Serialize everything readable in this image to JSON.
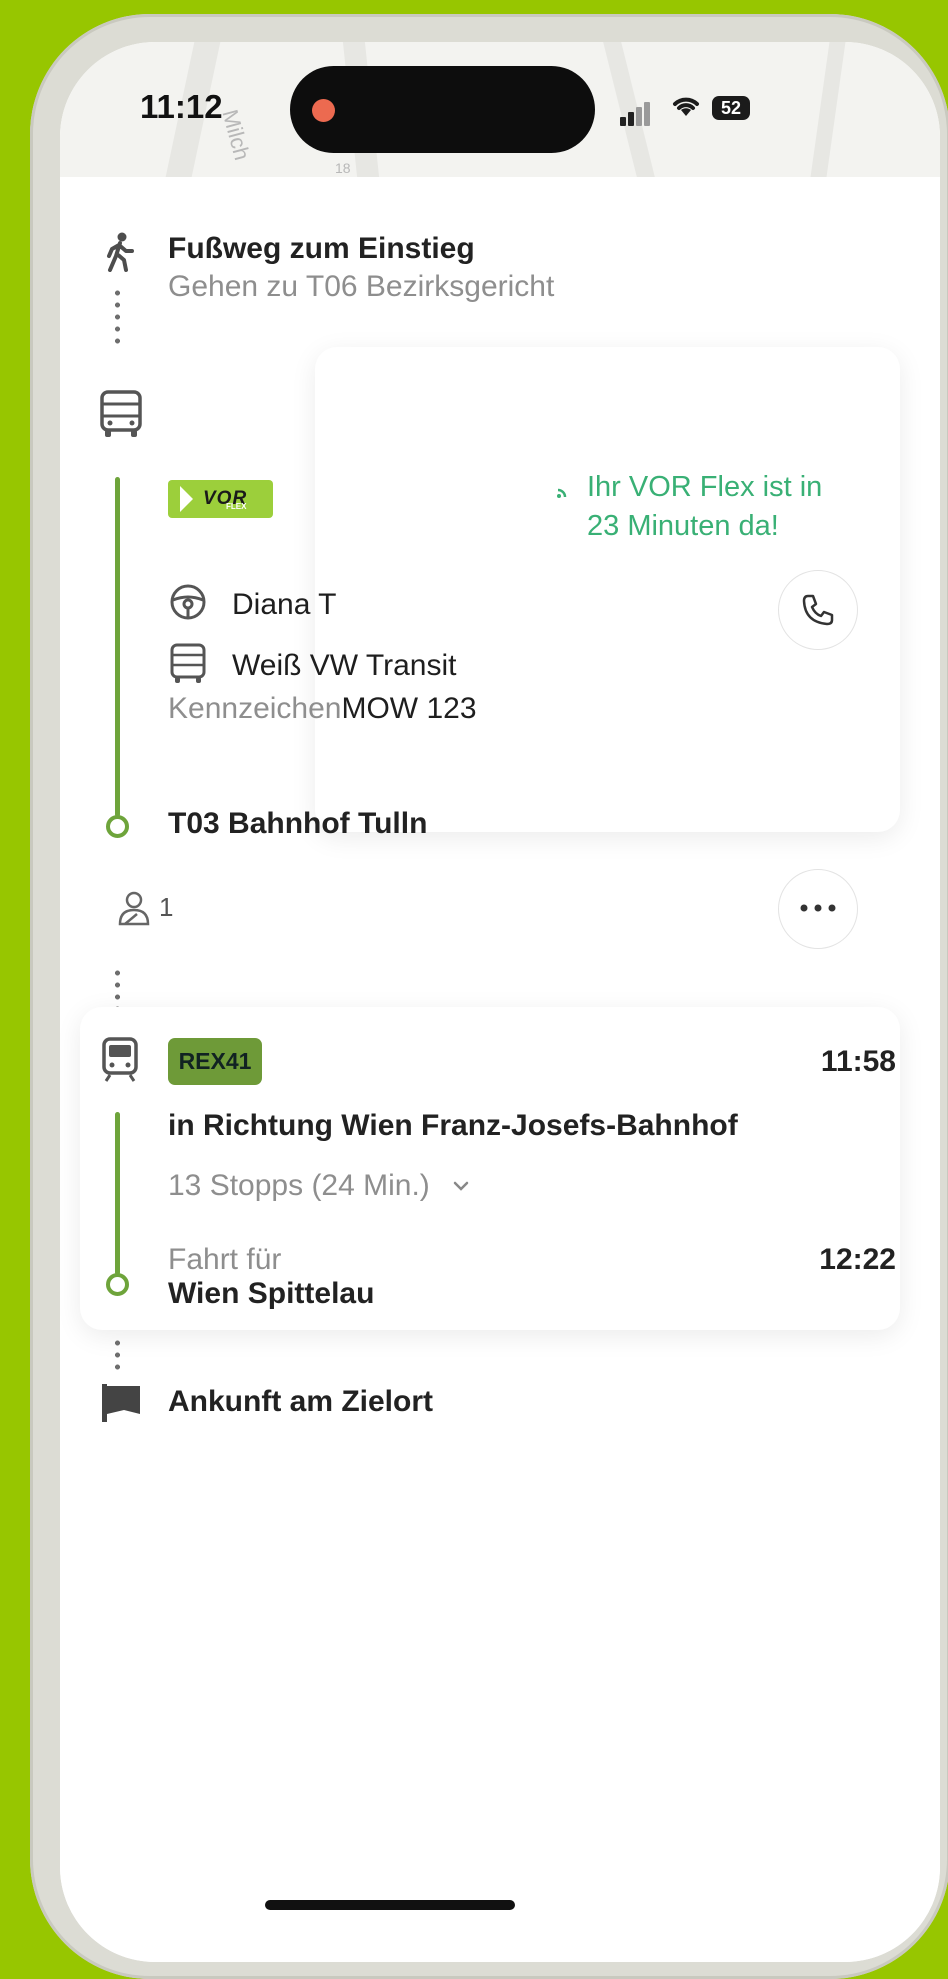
{
  "status_bar": {
    "time": "11:12",
    "battery": "52"
  },
  "map": {
    "street_label": "Milch",
    "number_label": "18"
  },
  "walk_step": {
    "title": "Fußweg zum Einstieg",
    "subtitle": "Gehen zu T06 Bezirksgericht"
  },
  "flex_leg": {
    "brand": "VOR",
    "brand_sub": "FLEX",
    "eta_message": "Ihr VOR Flex ist in 23 Minuten da!",
    "driver_name": "Diana T",
    "vehicle": "Weiß VW Transit",
    "plate_label": "Kennzeichen",
    "plate_value": "MOW 123",
    "destination": "T03 Bahnhof Tulln",
    "passengers": "1"
  },
  "train_leg": {
    "line": "REX41",
    "departure_time": "11:58",
    "direction": "in Richtung Wien Franz-Josefs-Bahnhof",
    "stops": "13 Stopps (24 Min.)",
    "ride_label": "Fahrt für",
    "arrival_time": "12:22",
    "arrival_stop": "Wien Spittelau"
  },
  "arrival_step": {
    "title": "Ankunft am Zielort"
  },
  "colors": {
    "accent_green": "#6ea43b",
    "eta_green": "#39b075",
    "background": "#97c600"
  }
}
